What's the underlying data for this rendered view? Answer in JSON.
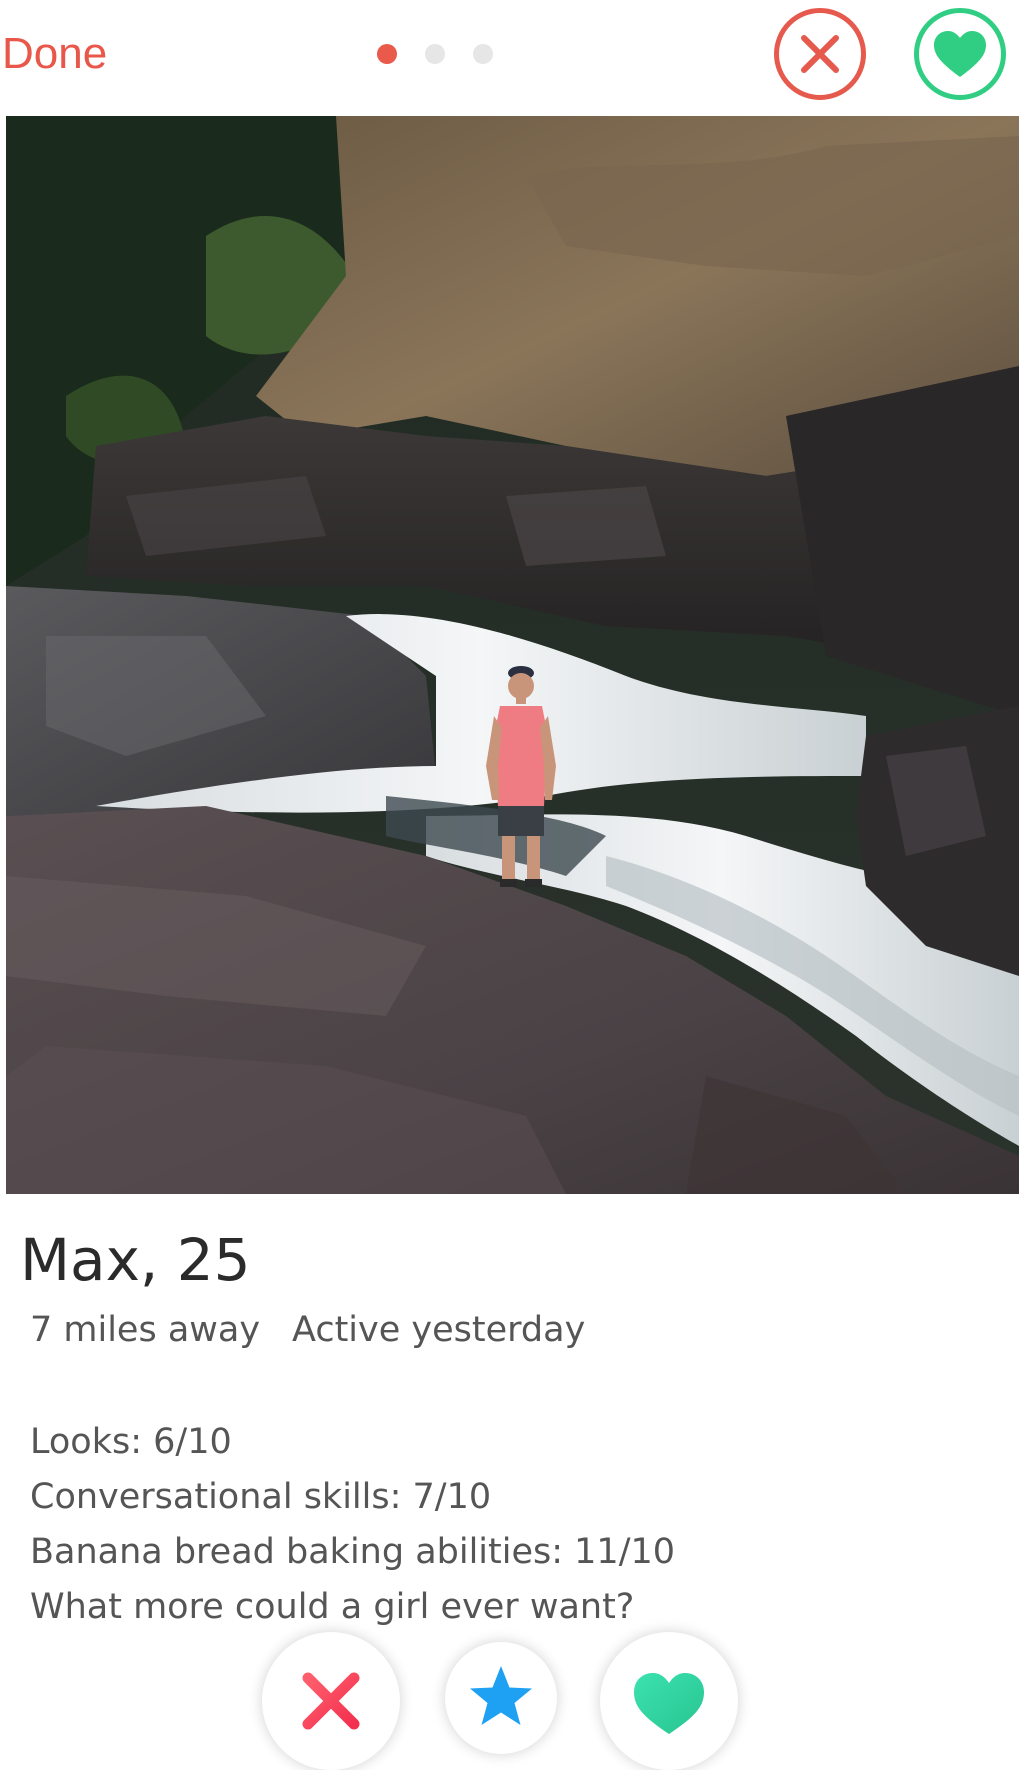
{
  "header": {
    "done_label": "Done",
    "photo_indicator": {
      "count": 3,
      "active_index": 0
    },
    "close_icon": "close-circle-icon",
    "like_icon": "heart-circle-icon"
  },
  "profile": {
    "name_age": "Max, 25",
    "distance": "7 miles away",
    "activity": "Active yesterday",
    "bio": [
      "Looks: 6/10",
      "Conversational skills: 7/10",
      "Banana bread baking abilities: 11/10",
      "What more could a girl ever want?"
    ]
  },
  "actions": {
    "nope_icon": "x-icon",
    "superlike_icon": "star-icon",
    "like_icon": "heart-icon"
  },
  "colors": {
    "accent_red": "#e8574a",
    "like_green": "#2fce82",
    "superlike_blue": "#1ea1f2",
    "heart_teal": "#34d1a5",
    "dot_inactive": "#e6e6e6"
  }
}
